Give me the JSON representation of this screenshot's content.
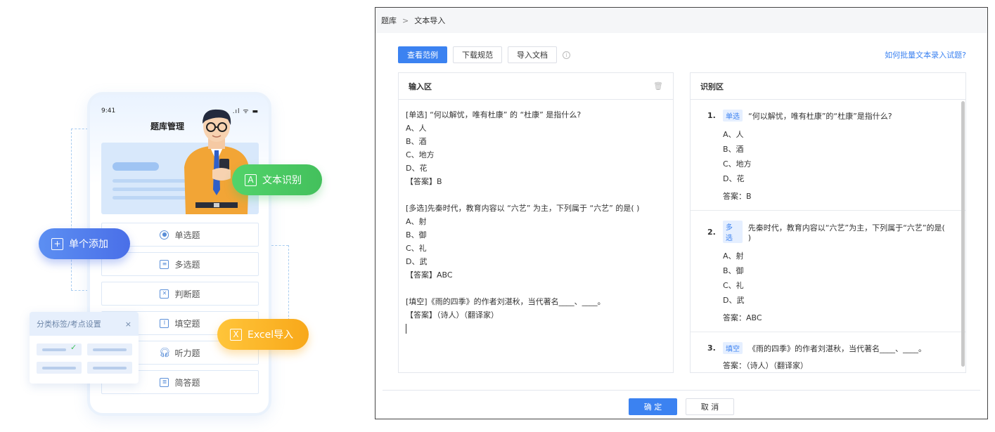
{
  "illustration": {
    "phone": {
      "time": "9:41",
      "status": ".ıl ᯤ ▬",
      "title": "题库管理",
      "question_types": [
        {
          "label": "单选题",
          "icon": "radio-icon"
        },
        {
          "label": "多选题",
          "icon": "list-icon"
        },
        {
          "label": "判断题",
          "icon": "cross-box-icon"
        },
        {
          "label": "填空题",
          "icon": "text-cursor-icon"
        },
        {
          "label": "听力题",
          "icon": "headphones-icon"
        },
        {
          "label": "简答题",
          "icon": "document-icon"
        }
      ]
    },
    "chips": {
      "text_recognition": "文本识别",
      "single_add": "单个添加",
      "excel_import": "Excel导入"
    },
    "tag_card": {
      "title": "分类标签/考点设置",
      "close": "×"
    }
  },
  "dialog": {
    "breadcrumb": [
      "题库",
      "文本导入"
    ],
    "breadcrumb_separator": ">",
    "toolbar": {
      "view_example": "查看范例",
      "download_spec": "下载规范",
      "import_doc": "导入文档",
      "info": "i"
    },
    "help_link": "如何批量文本录入试题?",
    "input_panel": {
      "title": "输入区",
      "lines": [
        "[单选] “何以解忧，唯有杜康” 的 “杜康” 是指什么?",
        "A、人",
        "B、酒",
        "C、地方",
        "D、花",
        "【答案】B",
        "",
        "[多选]先秦时代，教育内容以 “六艺” 为主，下列属于 “六艺” 的是(   )",
        "A、射",
        "B、御",
        "C、礼",
        "D、武",
        "【答案】ABC",
        "",
        "[填空]《雨的四季》的作者刘湛秋，当代著名____、____。",
        "【答案】（诗人）（翻译家）"
      ]
    },
    "recognition_panel": {
      "title": "识别区",
      "questions": [
        {
          "num": "1.",
          "tag": "单选",
          "text": "“何以解忧，唯有杜康”的“杜康”是指什么?",
          "options": [
            "A、人",
            "B、酒",
            "C、地方",
            "D、花"
          ],
          "answer": "答案：B"
        },
        {
          "num": "2.",
          "tag": "多选",
          "text": "先秦时代，教育内容以“六艺”为主，下列属于“六艺”的是(   )",
          "options": [
            "A、射",
            "B、御",
            "C、礼",
            "D、武"
          ],
          "answer": "答案：ABC"
        },
        {
          "num": "3.",
          "tag": "填空",
          "text": "《雨的四季》的作者刘湛秋，当代著名____、____。",
          "options": [],
          "answer": "答案：（诗人）（翻译家）"
        }
      ]
    },
    "confirm": "确 定",
    "cancel": "取 消"
  }
}
